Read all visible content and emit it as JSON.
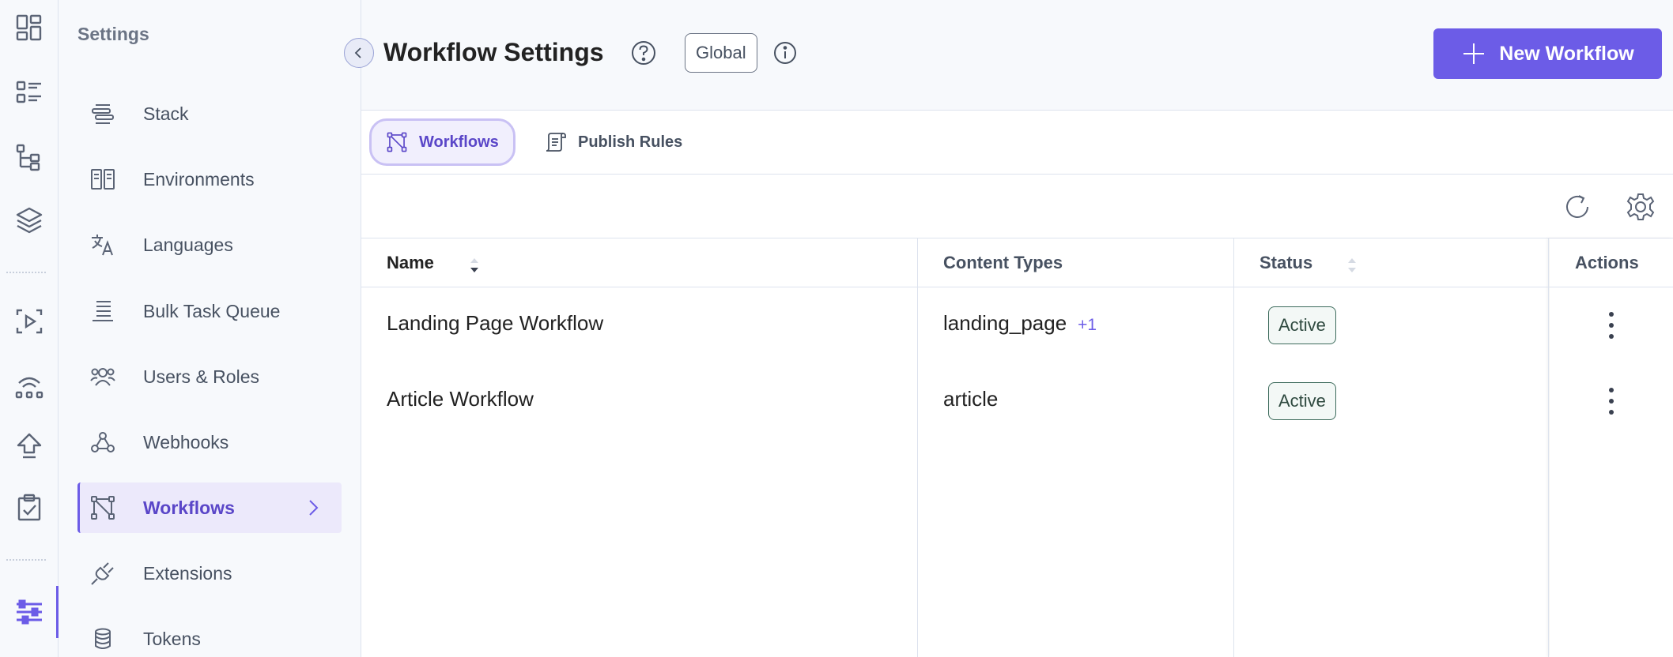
{
  "sidebar": {
    "title": "Settings",
    "items": [
      {
        "label": "Stack",
        "icon": "stack-icon"
      },
      {
        "label": "Environments",
        "icon": "environments-icon"
      },
      {
        "label": "Languages",
        "icon": "languages-icon"
      },
      {
        "label": "Bulk Task Queue",
        "icon": "bulk-task-queue-icon"
      },
      {
        "label": "Users & Roles",
        "icon": "users-roles-icon"
      },
      {
        "label": "Webhooks",
        "icon": "webhooks-icon"
      },
      {
        "label": "Workflows",
        "icon": "workflows-icon",
        "active": true
      },
      {
        "label": "Extensions",
        "icon": "extensions-icon"
      },
      {
        "label": "Tokens",
        "icon": "tokens-icon"
      }
    ]
  },
  "header": {
    "title": "Workflow Settings",
    "scope_badge": "Global",
    "new_button": "New Workflow"
  },
  "tabs": [
    {
      "label": "Workflows",
      "active": true
    },
    {
      "label": "Publish Rules",
      "active": false
    }
  ],
  "table": {
    "columns": [
      "Name",
      "Content Types",
      "Status",
      "Actions"
    ],
    "rows": [
      {
        "name": "Landing Page Workflow",
        "content_types": "landing_page",
        "more": "+1",
        "status": "Active"
      },
      {
        "name": "Article Workflow",
        "content_types": "article",
        "more": "",
        "status": "Active"
      }
    ]
  },
  "colors": {
    "accent": "#6c5ce7",
    "accent_text": "#5a46c8",
    "sidebar_bg": "#f7f9fc",
    "border": "#dde3ee",
    "status_border": "#3d6b5c"
  }
}
